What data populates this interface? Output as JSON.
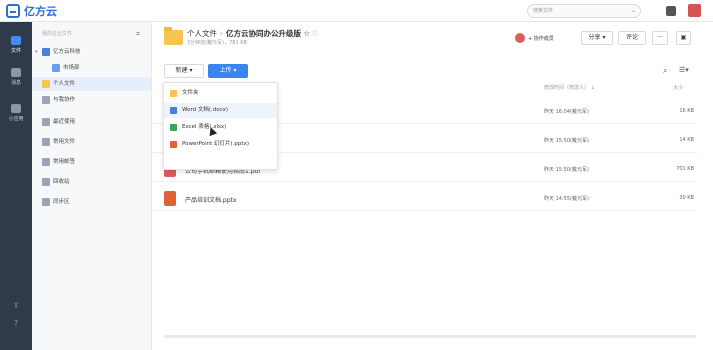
{
  "app": {
    "logo_text": "亿方云",
    "search_placeholder": "搜索文件",
    "brand_color": "#2b6fd6"
  },
  "leftnav": {
    "items": [
      {
        "label": "文件",
        "icon": "file-icon",
        "active": true
      },
      {
        "label": "消息",
        "icon": "message-icon",
        "active": false
      },
      {
        "label": "小应用",
        "icon": "apps-icon",
        "active": false
      }
    ],
    "bottom_icons": [
      "upload-icon",
      "help-icon"
    ]
  },
  "sidebar": {
    "header": "我的企业文件",
    "items": [
      {
        "label": "亿方云科技",
        "icon": "org-icon"
      },
      {
        "label": "市场部",
        "icon": "team-icon"
      },
      {
        "label": "个人文件",
        "icon": "personal-folder-icon"
      },
      {
        "label": "与我协作",
        "icon": "collab-icon"
      },
      {
        "label": "最近使用",
        "icon": "recent-icon"
      },
      {
        "label": "常用文件",
        "icon": "favorites-icon"
      },
      {
        "label": "常用邮签",
        "icon": "tag-icon"
      },
      {
        "label": "回收站",
        "icon": "trash-icon"
      },
      {
        "label": "同步区",
        "icon": "sync-icon"
      }
    ]
  },
  "header": {
    "breadcrumb_root": "个人文件",
    "breadcrumb_current": "亿方云协同办公升级版",
    "subline": "3分钟前(戴元军)，781 KB",
    "collab_label": "+ 协作成员",
    "share_label": "分享",
    "comment_label": "评论",
    "more_label": "···"
  },
  "toolbar": {
    "new_label": "新建",
    "upload_label": "上传"
  },
  "columns": {
    "modified": "修改时间（修改人）",
    "size": "大小"
  },
  "dropdown": {
    "items": [
      {
        "label": "文件夹",
        "color": "#f5c54e"
      },
      {
        "label": "Word 文档(.docx)",
        "color": "#4a7fe0"
      },
      {
        "label": "Excel 表格(.xlsx)",
        "color": "#3aa55c"
      },
      {
        "label": "PowerPoint 幻灯片(.pptx)",
        "color": "#e0603a"
      }
    ]
  },
  "files": [
    {
      "name": "sx",
      "date": "昨天 16:04(戴元军)",
      "size": "16 KB",
      "color": "#3aa55c"
    },
    {
      "name": "ocx",
      "date": "昨天 15:50(戴元军)",
      "size": "14 KB",
      "color": "#4a7fe0"
    },
    {
      "name": "公司手机邮箱使用指南1.pdf",
      "date": "昨天 15:50(戴元军)",
      "size": "701 KB",
      "color": "#e05c5c"
    },
    {
      "name": "产品培训文档.pptx",
      "date": "昨天 14:55(戴元军)",
      "size": "30 KB",
      "color": "#e0603a"
    }
  ]
}
